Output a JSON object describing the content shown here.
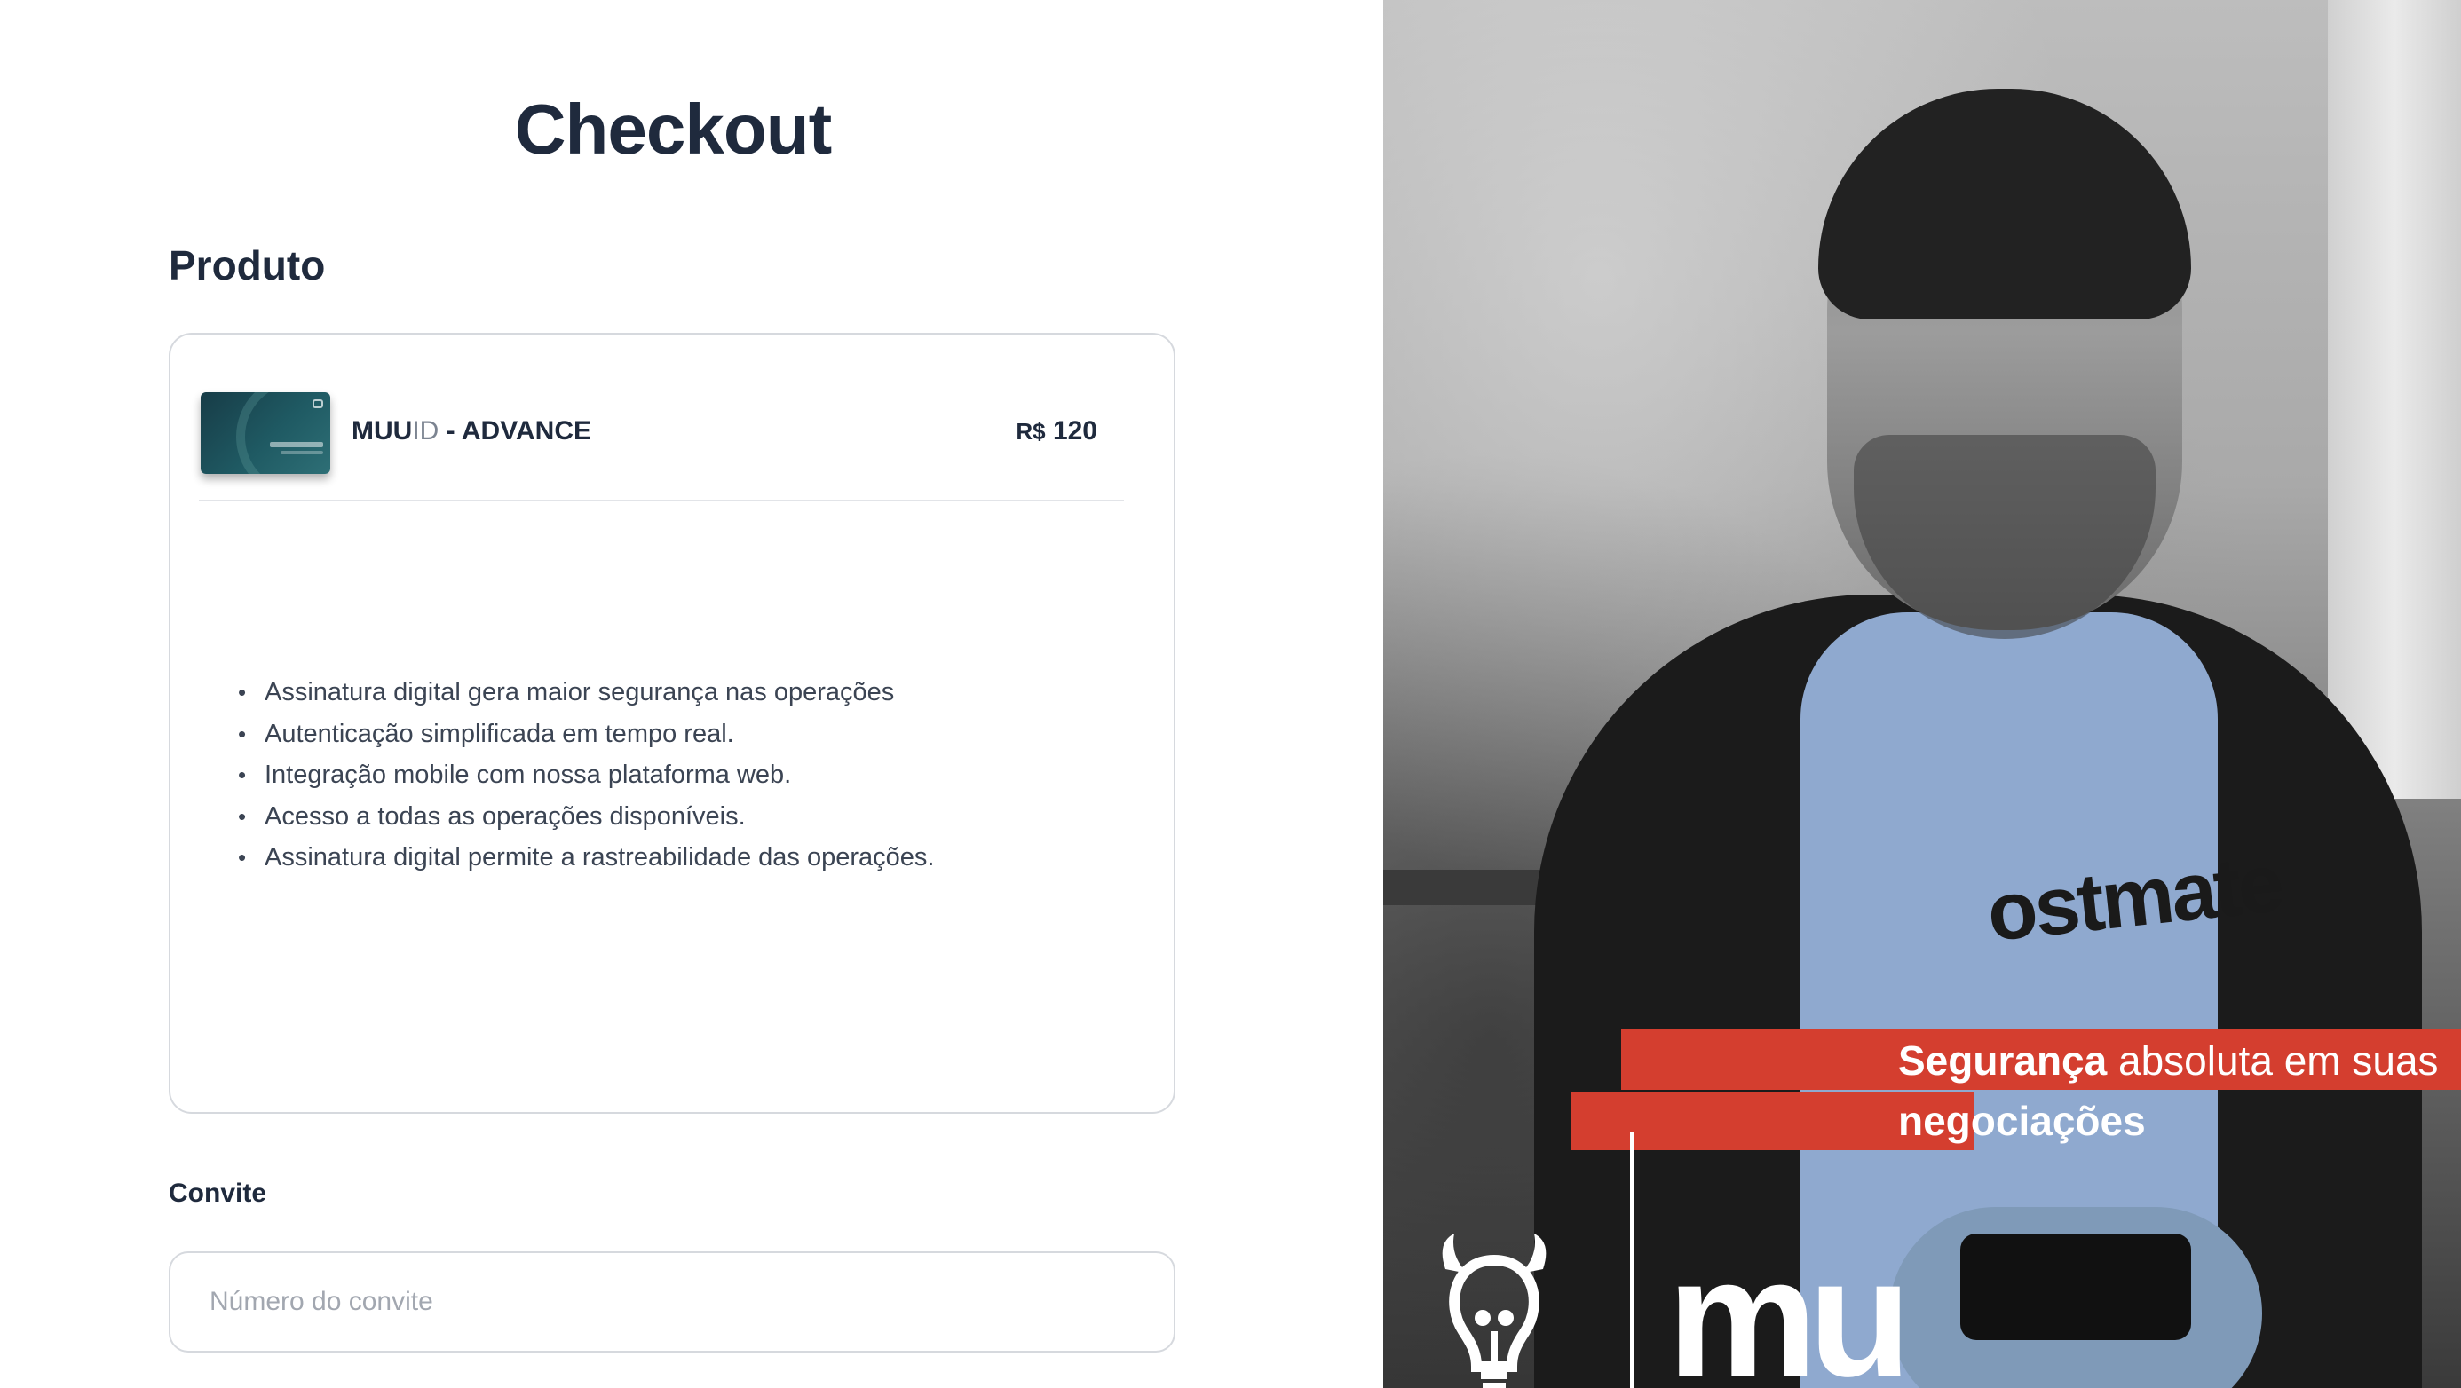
{
  "page": {
    "title": "Checkout"
  },
  "product_section": {
    "title": "Produto",
    "item": {
      "name_bold": "MUU",
      "name_light": "ID",
      "name_rest": " - ADVANCE",
      "currency": "R$",
      "price": "120"
    },
    "features": [
      "Assinatura digital gera maior segurança nas operações",
      "Autenticação simplificada em tempo real.",
      "Integração mobile com nossa plataforma web.",
      "Acesso a todas as operações disponíveis.",
      "Assinatura digital permite a rastreabilidade das operações."
    ]
  },
  "invite": {
    "label": "Convite",
    "placeholder": "Número do convite",
    "value": ""
  },
  "hero": {
    "tagline_bold": "Segurança",
    "tagline_rest": " absoluta em suas",
    "tagline_line2": "negociações",
    "shirt_text": "ostmate",
    "brand_text": "mu",
    "accent_color": "#d43e2f",
    "icon": "bull-lightbulb-icon"
  }
}
